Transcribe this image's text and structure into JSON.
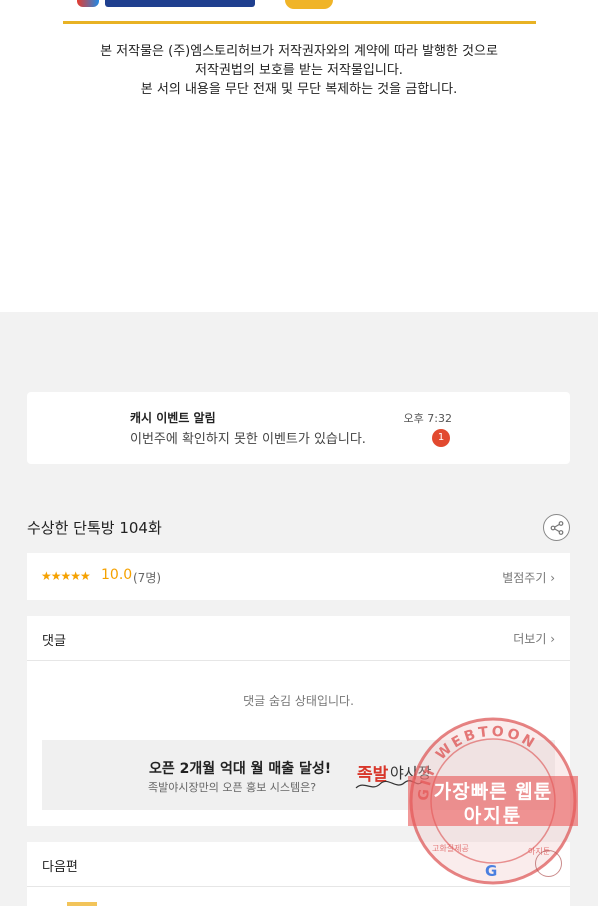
{
  "copyright": {
    "line1": "본 저작물은 (주)엠스토리허브가 저작권자와의 계약에 따라 발행한 것으로",
    "line2": "저작권법의 보호를 받는 저작물입니다.",
    "line3": "본 서의 내용을 무단 전재 및 무단 복제하는 것을 금합니다."
  },
  "notification": {
    "title": "캐시 이벤트 알림",
    "message": "이번주에 확인하지 못한 이벤트가 있습니다.",
    "time": "오후 7:32",
    "badge": "1"
  },
  "episode": {
    "title": "수상한 단톡방 104화",
    "share_icon": "share-icon"
  },
  "rating": {
    "stars": "★★★★★",
    "score": "10.0",
    "count": "(7명)",
    "rate_link": "별점주기 ›"
  },
  "comments": {
    "label": "댓글",
    "more": "더보기 ›",
    "hidden_message": "댓글 숨김 상태입니다."
  },
  "ad": {
    "title": "오픈 2개월 억대 월 매출 달성!",
    "subtitle": "족발야시장만의 오픈 홍보 시스템은?",
    "logo_red": "족발",
    "logo_dark": "야시장"
  },
  "next": {
    "label": "다음편"
  },
  "watermark": {
    "ring_text": "GIT WEBTOON",
    "line1": "가장빠른 웹툰",
    "line2": "아지툰",
    "side_left": "고화질제공",
    "side_right": "아지툰",
    "google": "G"
  },
  "colors": {
    "accent_gold": "#e8b224",
    "star": "#f5a100",
    "badge_red": "#e2492f",
    "watermark_red": "#e85a5a"
  }
}
